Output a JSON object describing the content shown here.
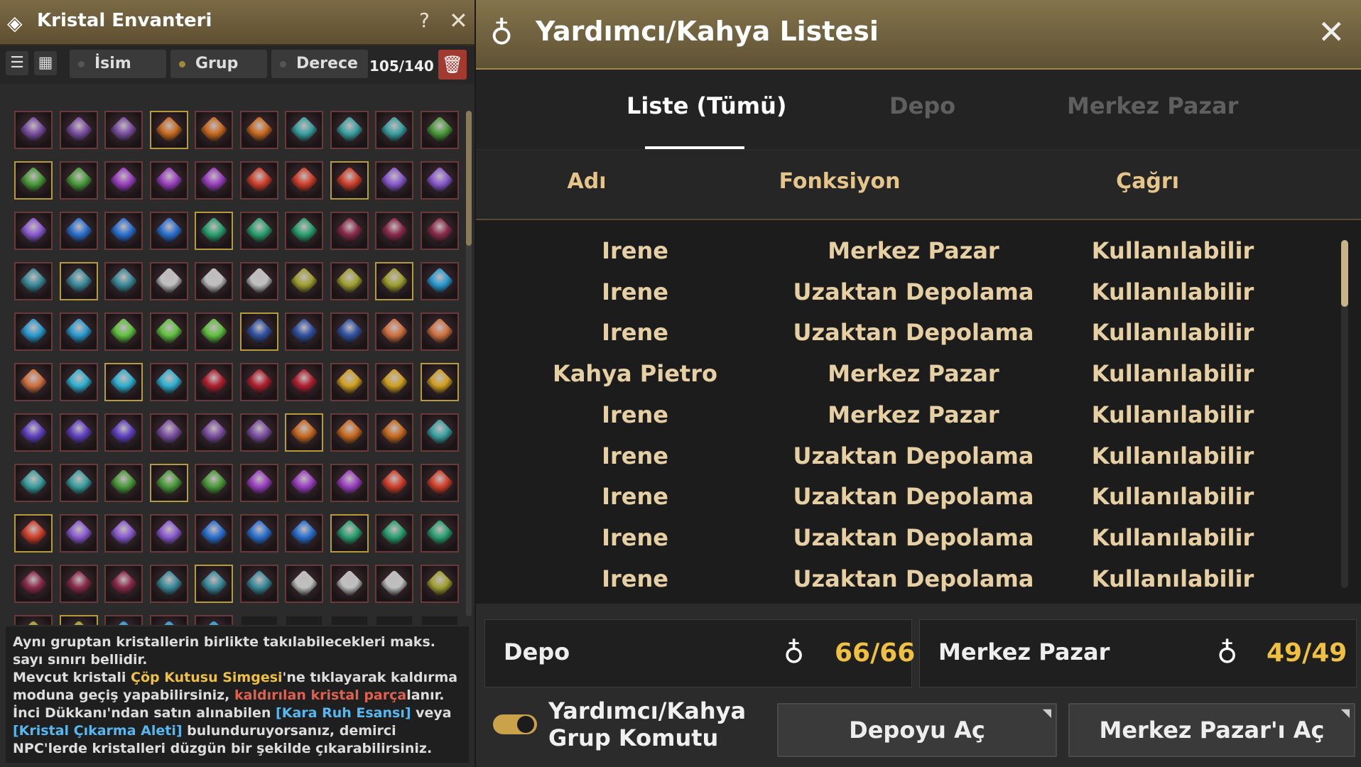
{
  "inventory": {
    "title": "Kristal Envanteri",
    "help": "?",
    "close": "✕",
    "sort_buttons": [
      {
        "label": "İsim",
        "active": false
      },
      {
        "label": "Grup",
        "active": true
      },
      {
        "label": "Derece",
        "active": false
      }
    ],
    "count": "105/140",
    "gem_colors": [
      "#7a4ea0",
      "#c86a20",
      "#3aa0a0",
      "#4a9a3a",
      "#9a40c0",
      "#d0402a",
      "#8a5ad0",
      "#2a70d0",
      "#2aa070",
      "#8a2a4a",
      "#3a8a9a",
      "#c0c0c0",
      "#a0a030",
      "#2a9ad0",
      "#60c040",
      "#3050a0",
      "#d07040",
      "#30b0d0",
      "#b02030",
      "#d0a020",
      "#6040c0"
    ],
    "hint": {
      "l1": "Aynı gruptan kristallerin birlikte takılabilecekleri maks. sayı sınırı bellidir.",
      "l2a": "Mevcut kristali ",
      "l2b": "Çöp Kutusu Simgesi",
      "l2c": "'ne tıklayarak kaldırma moduna geçiş yapabilirsiniz, ",
      "l2d": "kaldırılan kristal parça",
      "l2e": "lanır.",
      "l3a": "İnci Dükkanı'ndan satın alınabilen ",
      "l3b": "[Kara Ruh Esansı]",
      "l3c": " veya ",
      "l3d": "[Kristal Çıkarma Aleti]",
      "l3e": " bulunduruyorsanız, demirci NPC'lerde kristalleri düzgün bir şekilde çıkarabilirsiniz."
    }
  },
  "list": {
    "title": "Yardımcı/Kahya Listesi",
    "close": "✕",
    "tabs": {
      "all": "Liste (Tümü)",
      "depo": "Depo",
      "merkez": "Merkez Pazar"
    },
    "columns": {
      "name": "Adı",
      "function": "Fonksiyon",
      "call": "Çağrı"
    },
    "rows": [
      {
        "name": "Irene",
        "function": "Merkez Pazar",
        "call": "Kullanılabilir"
      },
      {
        "name": "Irene",
        "function": "Uzaktan Depolama",
        "call": "Kullanılabilir"
      },
      {
        "name": "Irene",
        "function": "Uzaktan Depolama",
        "call": "Kullanılabilir"
      },
      {
        "name": "Kahya Pietro",
        "function": "Merkez Pazar",
        "call": "Kullanılabilir"
      },
      {
        "name": "Irene",
        "function": "Merkez Pazar",
        "call": "Kullanılabilir"
      },
      {
        "name": "Irene",
        "function": "Uzaktan Depolama",
        "call": "Kullanılabilir"
      },
      {
        "name": "Irene",
        "function": "Uzaktan Depolama",
        "call": "Kullanılabilir"
      },
      {
        "name": "Irene",
        "function": "Uzaktan Depolama",
        "call": "Kullanılabilir"
      },
      {
        "name": "Irene",
        "function": "Uzaktan Depolama",
        "call": "Kullanılabilir"
      }
    ],
    "depo": {
      "label": "Depo",
      "value": "66/66"
    },
    "merkez": {
      "label": "Merkez Pazar",
      "value": "49/49"
    },
    "toggle_label": "Yardımcı/Kahya Grup Komutu",
    "open_depo": "Depoyu Aç",
    "open_merkez": "Merkez Pazar'ı Aç"
  }
}
